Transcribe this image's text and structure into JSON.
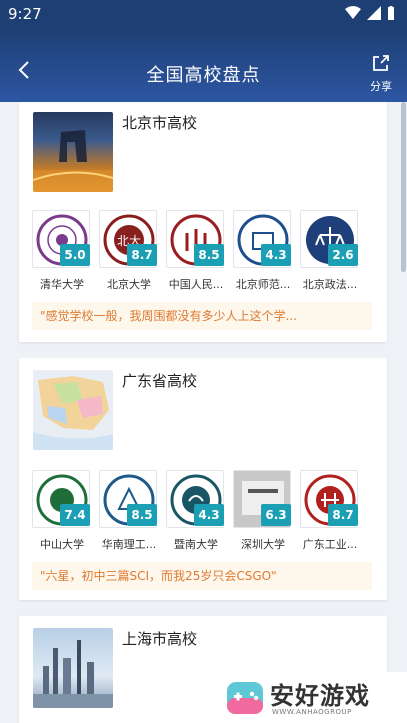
{
  "status": {
    "time": "9:27"
  },
  "header": {
    "title": "全国高校盘点",
    "share_label": "分享"
  },
  "sections": [
    {
      "title": "北京市高校",
      "universities": [
        {
          "name": "清华大学",
          "score": "5.0",
          "color": "#7b3a8c"
        },
        {
          "name": "北京大学",
          "score": "8.7",
          "color": "#8a1f1f"
        },
        {
          "name": "中国人民...",
          "score": "8.5",
          "color": "#9b1c20"
        },
        {
          "name": "北京师范...",
          "score": "4.3",
          "color": "#1e4f8d"
        },
        {
          "name": "北京政法...",
          "score": "2.6",
          "color": "#1f3f7a"
        }
      ],
      "quote": "\"感觉学校一般，我周围都没有多少人上这个学..."
    },
    {
      "title": "广东省高校",
      "universities": [
        {
          "name": "中山大学",
          "score": "7.4",
          "color": "#1f6e3a"
        },
        {
          "name": "华南理工...",
          "score": "8.5",
          "color": "#1f5a8a"
        },
        {
          "name": "暨南大学",
          "score": "4.3",
          "color": "#1a5566"
        },
        {
          "name": "深圳大学",
          "score": "6.3",
          "color": "#555"
        },
        {
          "name": "广东工业...",
          "score": "8.7",
          "color": "#b0201e"
        }
      ],
      "quote": "\"六星，初中三篇SCI，而我25岁只会CSGO\""
    },
    {
      "title": "上海市高校"
    }
  ],
  "watermark": {
    "text": "安好游戏",
    "sub": "WWW.ANHAOGROUP"
  },
  "colors": {
    "header": "#1e3f73",
    "score_badge": "#1b9fb4",
    "quote_text": "#e07a30",
    "quote_bg": "#fdf7ec"
  }
}
